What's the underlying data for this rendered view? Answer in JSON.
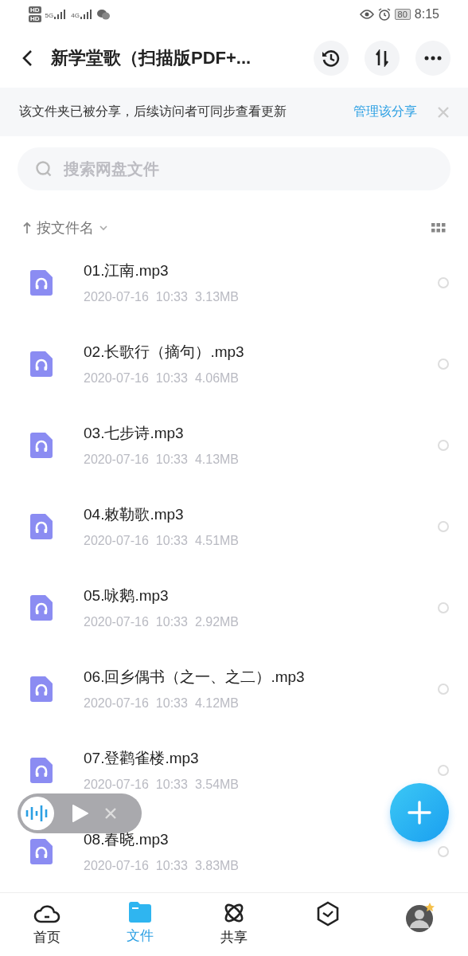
{
  "status_bar": {
    "sim_badges": [
      "HD",
      "HD"
    ],
    "networks": [
      "5G",
      "4G"
    ],
    "battery": "80",
    "time": "8:15"
  },
  "header": {
    "title": "新学堂歌（扫描版PDF+..."
  },
  "banner": {
    "text": "该文件夹已被分享，后续访问者可同步查看更新",
    "link": "管理该分享"
  },
  "search": {
    "placeholder": "搜索网盘文件"
  },
  "sort": {
    "label": "按文件名"
  },
  "files": [
    {
      "name": "01.江南.mp3",
      "date": "2020-07-16",
      "time": "10:33",
      "size": "3.13MB",
      "selected": false
    },
    {
      "name": "02.长歌行（摘句）.mp3",
      "date": "2020-07-16",
      "time": "10:33",
      "size": "4.06MB",
      "selected": false
    },
    {
      "name": "03.七步诗.mp3",
      "date": "2020-07-16",
      "time": "10:33",
      "size": "4.13MB",
      "selected": false
    },
    {
      "name": "04.敕勒歌.mp3",
      "date": "2020-07-16",
      "time": "10:33",
      "size": "4.51MB",
      "selected": false
    },
    {
      "name": "05.咏鹅.mp3",
      "date": "2020-07-16",
      "time": "10:33",
      "size": "2.92MB",
      "selected": false
    },
    {
      "name": "06.回乡偶书（之一、之二）.mp3",
      "date": "2020-07-16",
      "time": "10:33",
      "size": "4.12MB",
      "selected": false
    },
    {
      "name": "07.登鹳雀楼.mp3",
      "date": "2020-07-16",
      "time": "10:33",
      "size": "3.54MB",
      "selected": false
    },
    {
      "name": "08.春晓.mp3",
      "date": "2020-07-16",
      "time": "10:33",
      "size": "3.83MB",
      "selected": false
    }
  ],
  "nav": [
    {
      "kind": "home",
      "label": "首页",
      "selected": false
    },
    {
      "kind": "files",
      "label": "文件",
      "selected": true
    },
    {
      "kind": "share",
      "label": "共享",
      "selected": false
    },
    {
      "kind": "watch",
      "selected": false
    },
    {
      "kind": "avatar",
      "selected": false
    }
  ]
}
